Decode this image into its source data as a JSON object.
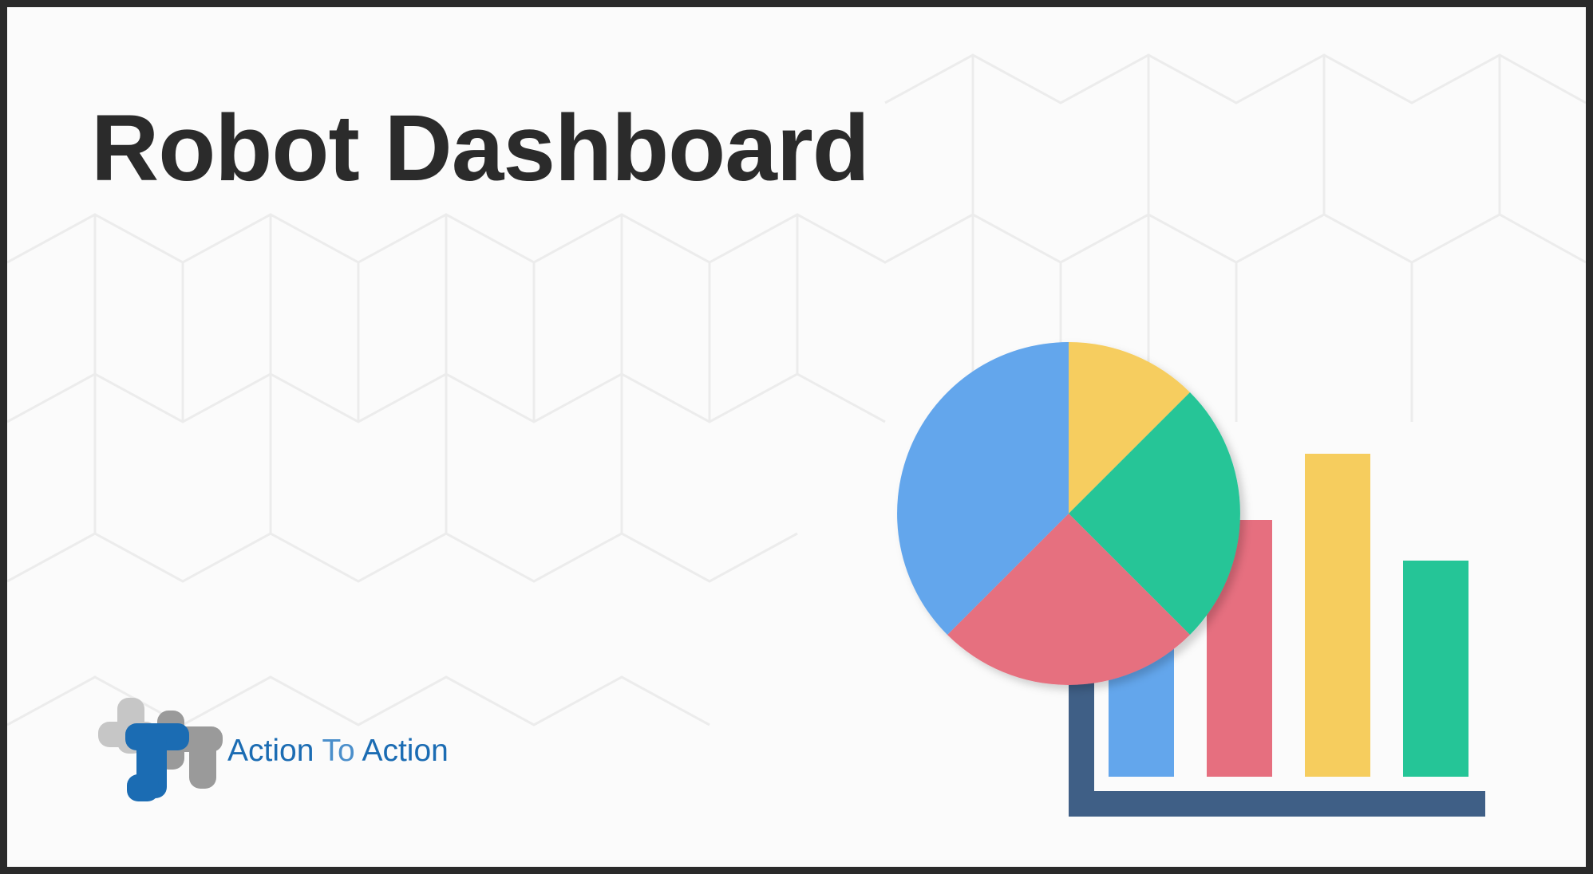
{
  "header": {
    "title": "Robot Dashboard"
  },
  "logo": {
    "word1": "Action",
    "word2": "To",
    "word3": "Action"
  },
  "illustration": {
    "icon": "dashboard-chart-illustration",
    "colors": {
      "blue": "#63a6ec",
      "red": "#e66f7f",
      "yellow": "#f6cd5e",
      "green": "#25c597",
      "axis": "#3f5f86"
    },
    "pie_fractions": [
      0.125,
      0.25,
      0.25,
      0.375
    ],
    "bar_levels": [
      0.43,
      0.77,
      0.95,
      0.63
    ]
  }
}
